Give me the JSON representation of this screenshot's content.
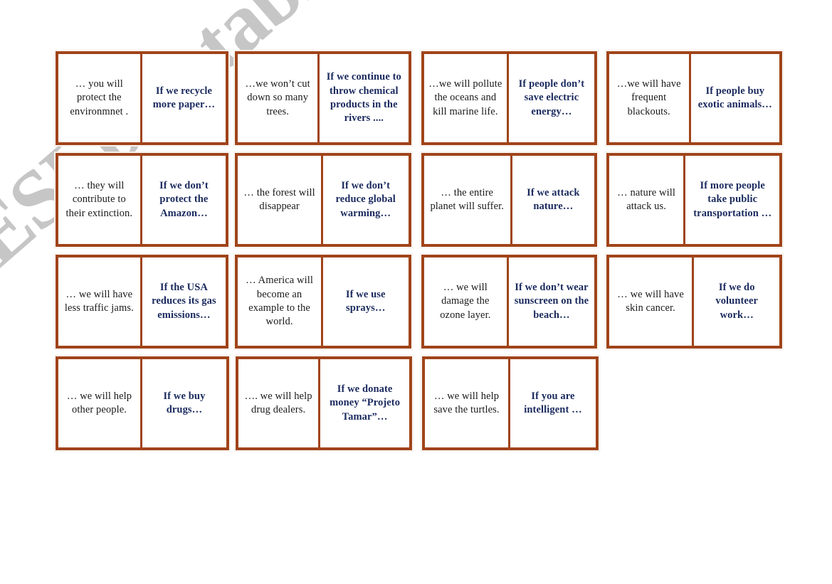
{
  "watermark": {
    "text": "ESLprintables.com"
  },
  "worksheet": {
    "type": "domino-cards",
    "rows": [
      {
        "dominoes": [
          {
            "answer": "… you will protect the environmnet .",
            "prompt": "If we recycle more paper…"
          },
          {
            "answer": "…we won’t cut down so many trees.",
            "prompt": "If we continue to throw chemical products in the rivers ...."
          },
          {
            "answer": "…we will pollute the oceans and kill marine life.",
            "prompt": "If people don’t save electric energy…"
          },
          {
            "answer": "…we will have frequent blackouts.",
            "prompt": "If people buy exotic animals…"
          }
        ]
      },
      {
        "dominoes": [
          {
            "answer": "… they will contribute to their extinction.",
            "prompt": "If we don’t protect the Amazon…"
          },
          {
            "answer": "… the forest will disappear",
            "prompt": "If we don’t reduce global warming…"
          },
          {
            "answer": "… the entire planet will suffer.",
            "prompt": "If we attack nature…"
          },
          {
            "answer": "… nature will attack us.",
            "prompt": "If more people take public transportation …"
          }
        ]
      },
      {
        "dominoes": [
          {
            "answer": "… we will have less traffic jams.",
            "prompt": "If the USA reduces its gas emissions…"
          },
          {
            "answer": "… America will become an example to the world.",
            "prompt": "If we use sprays…"
          },
          {
            "answer": "… we will damage the ozone layer.",
            "prompt": "If we don’t wear sunscreen on the beach…"
          },
          {
            "answer": "… we will have skin cancer.",
            "prompt": "If we do volunteer work…"
          }
        ]
      },
      {
        "dominoes": [
          {
            "answer": "… we will help other people.",
            "prompt": "If we buy drugs…"
          },
          {
            "answer": "…. we will help drug dealers.",
            "prompt": "If we donate money “Projeto Tamar”…"
          },
          {
            "answer": "… we will help save the turtles.",
            "prompt": "If you are intelligent …"
          }
        ]
      }
    ]
  },
  "colors": {
    "border_brown": "#a0441a",
    "prompt_navy": "#1a2a5e",
    "answer_black": "#1a1a1a",
    "watermark_gray": "#c4c4c4",
    "page_white": "#ffffff"
  }
}
